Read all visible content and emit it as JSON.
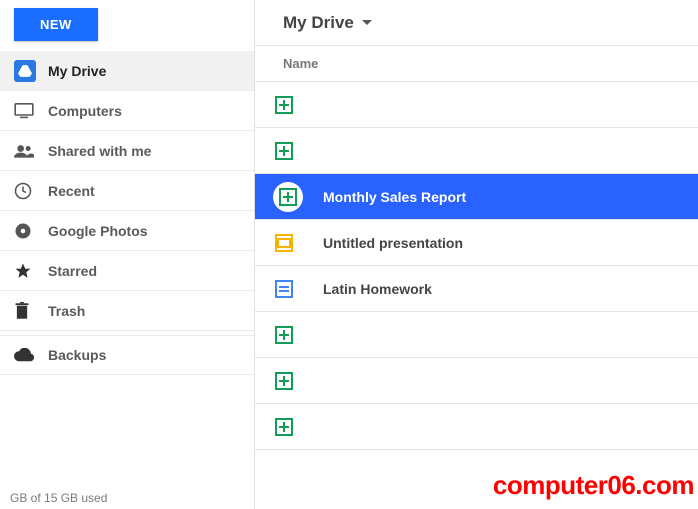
{
  "new_button": "NEW",
  "breadcrumb": "My Drive",
  "column_header": "Name",
  "sidebar": [
    {
      "id": "my-drive",
      "label": "My Drive",
      "selected": true
    },
    {
      "id": "computers",
      "label": "Computers",
      "selected": false
    },
    {
      "id": "shared",
      "label": "Shared with me",
      "selected": false
    },
    {
      "id": "recent",
      "label": "Recent",
      "selected": false
    },
    {
      "id": "photos",
      "label": "Google Photos",
      "selected": false
    },
    {
      "id": "starred",
      "label": "Starred",
      "selected": false
    },
    {
      "id": "trash",
      "label": "Trash",
      "selected": false
    },
    {
      "id": "backups",
      "label": "Backups",
      "selected": false
    }
  ],
  "storage": "GB of 15 GB used",
  "files": [
    {
      "name": "",
      "type": "sheets",
      "selected": false
    },
    {
      "name": "",
      "type": "sheets",
      "selected": false
    },
    {
      "name": "Monthly Sales Report",
      "type": "sheets",
      "selected": true
    },
    {
      "name": "Untitled presentation",
      "type": "slides",
      "selected": false
    },
    {
      "name": "Latin Homework",
      "type": "docs",
      "selected": false
    },
    {
      "name": "",
      "type": "sheets",
      "selected": false
    },
    {
      "name": "",
      "type": "sheets",
      "selected": false
    },
    {
      "name": "",
      "type": "sheets",
      "selected": false
    }
  ],
  "watermark": "computer06.com"
}
